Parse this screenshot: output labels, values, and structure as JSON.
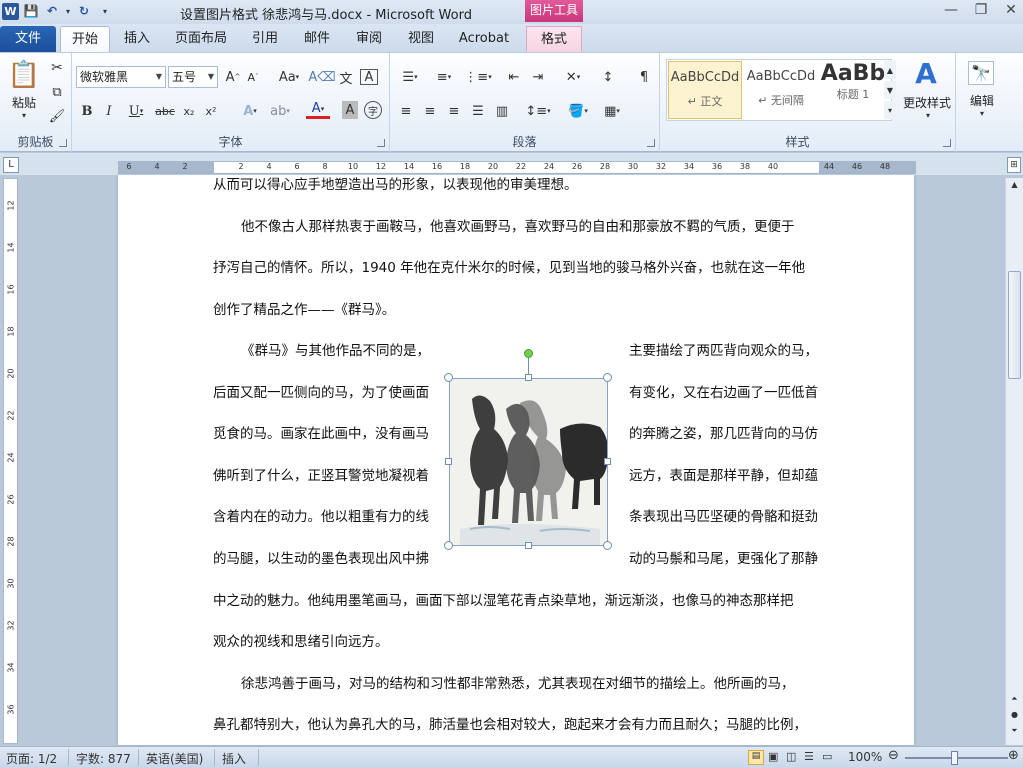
{
  "window": {
    "title": "设置图片格式  徐悲鸿与马.docx  -  Microsoft Word",
    "context_tab": "图片工具",
    "controls": [
      "—",
      "❐",
      "✕"
    ]
  },
  "qat": {
    "logo": "W",
    "save": "💾",
    "undo": "↶",
    "redo": "↻",
    "more": "▾"
  },
  "tabs": {
    "file": "文件",
    "home": "开始",
    "insert": "插入",
    "layout": "页面布局",
    "refs": "引用",
    "mail": "邮件",
    "review": "审阅",
    "view": "视图",
    "acrobat": "Acrobat",
    "format": "格式"
  },
  "ribbon": {
    "clipboard": {
      "paste": "粘贴",
      "label": "剪贴板"
    },
    "font": {
      "face": "微软雅黑",
      "size": "五号",
      "label": "字体"
    },
    "paragraph": {
      "label": "段落"
    },
    "styles": {
      "items": [
        {
          "sample": "AaBbCcDd",
          "name": "↵ 正文"
        },
        {
          "sample": "AaBbCcDd",
          "name": "↵ 无间隔"
        },
        {
          "sample": "AaBb",
          "name": "标题 1"
        }
      ],
      "change": "更改样式",
      "label": "样式"
    },
    "editing": {
      "label": "编辑"
    }
  },
  "ruler": {
    "h_ticks": [
      "6",
      "4",
      "2",
      "",
      "2",
      "4",
      "6",
      "8",
      "10",
      "12",
      "14",
      "16",
      "18",
      "20",
      "22",
      "24",
      "26",
      "28",
      "30",
      "32",
      "34",
      "36",
      "38",
      "40",
      "44",
      "46",
      "48"
    ],
    "v_ticks": [
      "12",
      "14",
      "16",
      "18",
      "20",
      "22",
      "24",
      "26",
      "28",
      "30",
      "32",
      "34",
      "36"
    ]
  },
  "document": {
    "lines_top": [
      "从而可以得心应手地塑造出马的形象，以表现他的审美理想。",
      "他不像古人那样热衷于画鞍马，他喜欢画野马，喜欢野马的自由和那豪放不羁的气质，更便于",
      "抒泻自己的情怀。所以，1940 年他在克什米尔的时候，见到当地的骏马格外兴奋，也就在这一年他",
      "创作了精品之作——《群马》。"
    ],
    "wrap_left": [
      "《群马》与其他作品不同的是，",
      "后面又配一匹侧向的马，为了使画面",
      "觅食的马。画家在此画中，没有画马",
      "佛听到了什么，正竖耳警觉地凝视着",
      "含着内在的动力。他以粗重有力的线",
      "的马腿，以生动的墨色表现出风中拂"
    ],
    "wrap_right": [
      "主要描绘了两匹背向观众的马，",
      "有变化，又在右边画了一匹低首",
      "的奔腾之姿，那几匹背向的马仿",
      "远方，表面是那样平静，但却蕴",
      "条表现出马匹坚硬的骨骼和挺劲",
      "动的马鬃和马尾，更强化了那静"
    ],
    "lines_bottom": [
      "中之动的魅力。他纯用墨笔画马，画面下部以湿笔花青点染草地，渐远渐淡，也像马的神态那样把",
      "观众的视线和思绪引向远方。",
      "徐悲鸿善于画马，对马的结构和习性都非常熟悉，尤其表现在对细节的描绘上。他所画的马，",
      "鼻孔都特别大，他认为鼻孔大的马，肺活量也会相对较大，跑起来才会有力而且耐久；马腿的比例，"
    ]
  },
  "status": {
    "page": "页面: 1/2",
    "words": "字数: 877",
    "lang": "英语(美国)",
    "mode": "插入",
    "zoom": "100%"
  }
}
